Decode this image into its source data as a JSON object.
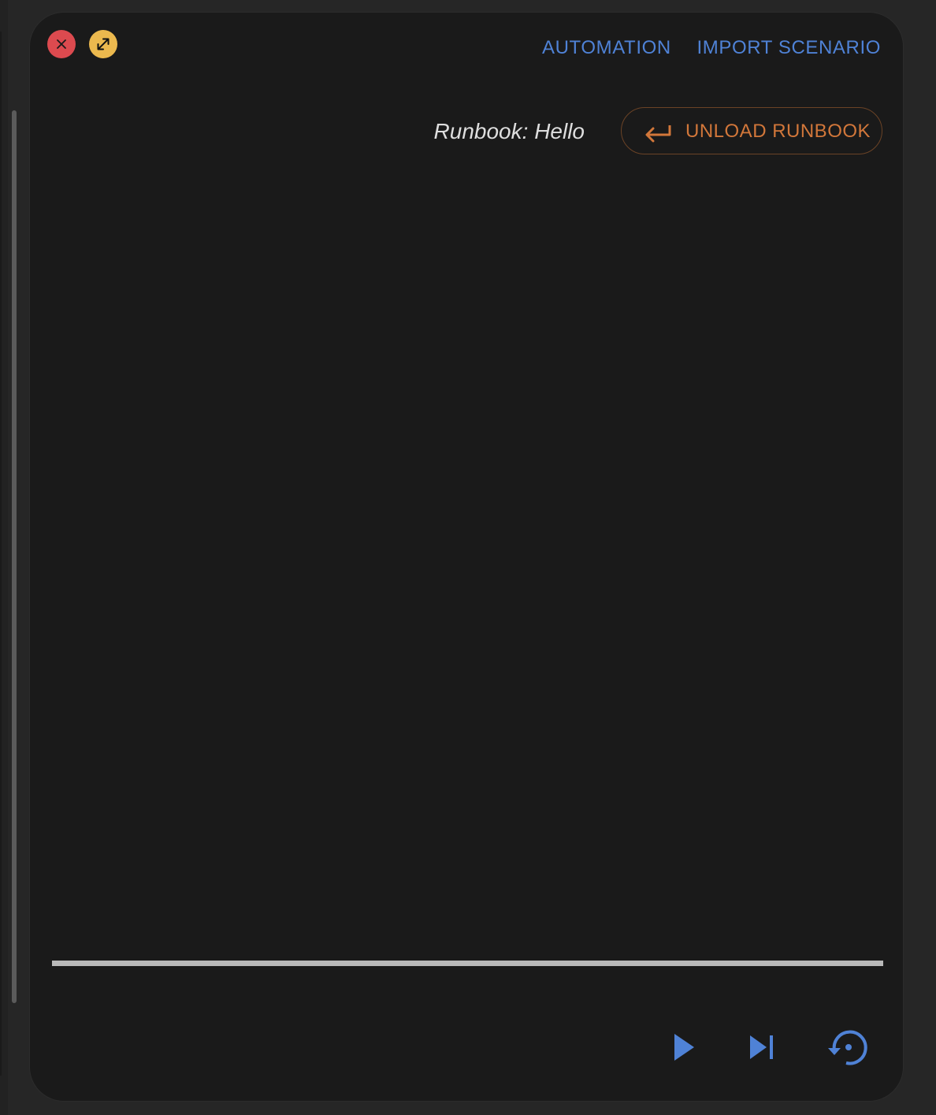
{
  "window_controls": {
    "close_icon": "close-icon",
    "expand_icon": "expand-diagonal-icon"
  },
  "header": {
    "links": [
      {
        "label": "AUTOMATION"
      },
      {
        "label": "IMPORT SCENARIO"
      }
    ]
  },
  "runbook": {
    "label": "Runbook: Hello",
    "unload_button": {
      "label": "UNLOAD RUNBOOK",
      "icon": "return-arrow-icon"
    }
  },
  "progress": {
    "fraction": 1.0
  },
  "controls": [
    {
      "icon": "play-icon"
    },
    {
      "icon": "skip-next-icon"
    },
    {
      "icon": "restart-icon"
    }
  ],
  "colors": {
    "background": "#1a1a1a",
    "accent_blue": "#4f82d6",
    "accent_orange": "#d2773a",
    "close_red": "#dc4a4f",
    "expand_yellow": "#ecb94e",
    "progress_fill": "#b9b9b9"
  }
}
